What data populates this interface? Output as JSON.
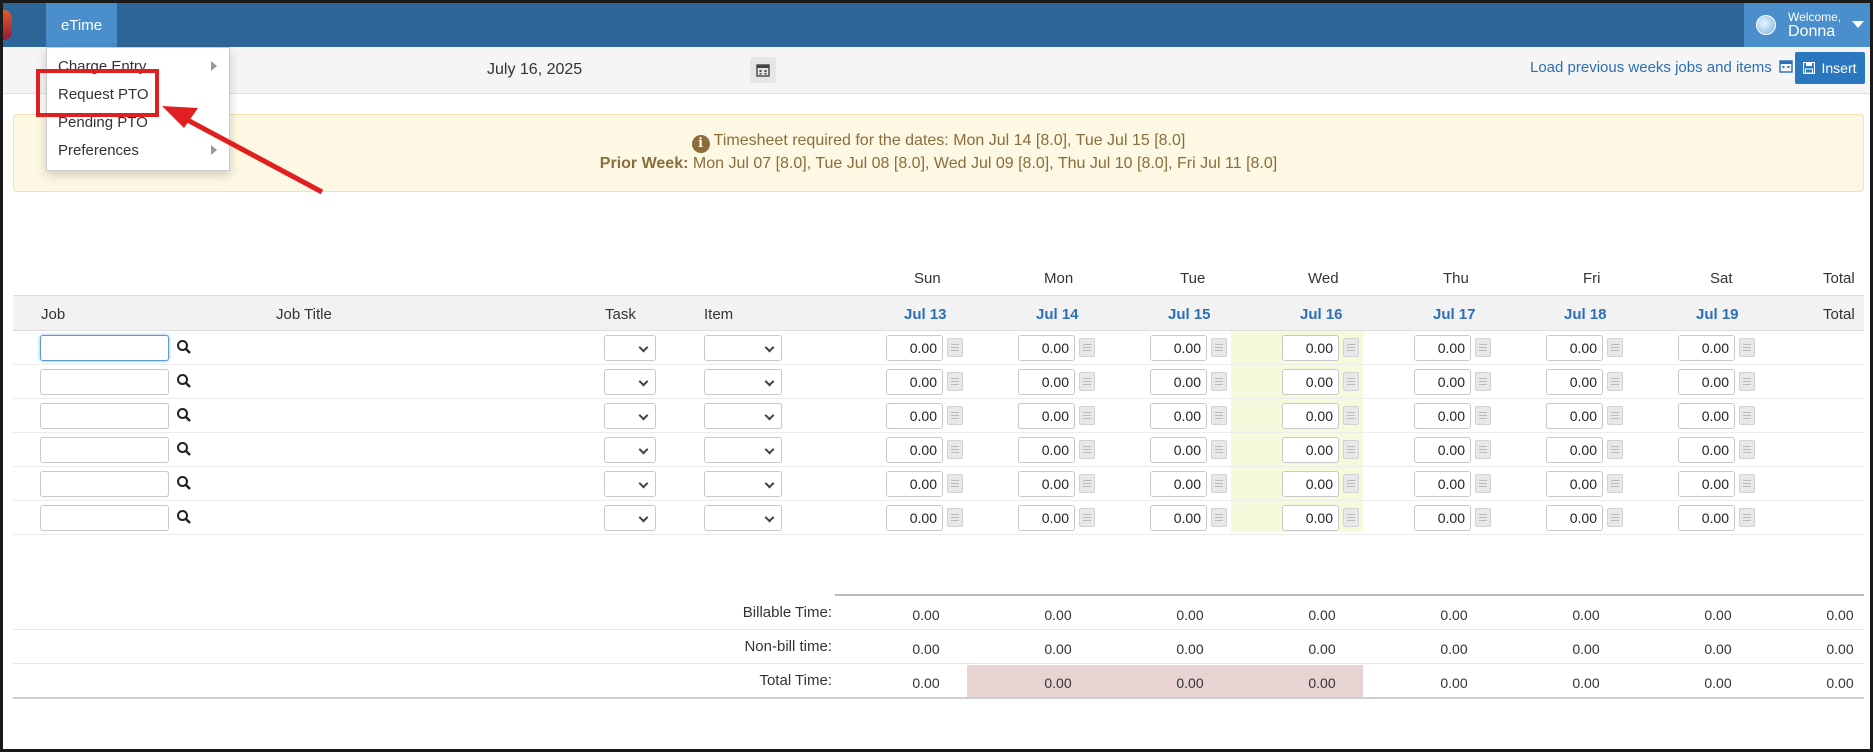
{
  "nav": {
    "app_label": "eTime",
    "welcome_line1": "Welcome,",
    "welcome_name": "Donna"
  },
  "menu": {
    "items": [
      {
        "label": "Charge Entry",
        "has_submenu": true
      },
      {
        "label": "Request PTO",
        "has_submenu": false
      },
      {
        "label": "Pending PTO",
        "has_submenu": false
      },
      {
        "label": "Preferences",
        "has_submenu": true
      }
    ]
  },
  "toolbar": {
    "date": "July 16, 2025",
    "load_previous": "Load previous weeks jobs and items",
    "insert_label": "Insert"
  },
  "alert": {
    "line1": "Timesheet required for the dates: Mon Jul 14 [8.0], Tue Jul 15 [8.0]",
    "prior_label": "Prior Week:",
    "prior_text": "Mon Jul 07 [8.0], Tue Jul 08 [8.0], Wed Jul 09 [8.0], Thu Jul 10 [8.0], Fri Jul 11 [8.0]"
  },
  "grid": {
    "day_names": [
      "Sun",
      "Mon",
      "Tue",
      "Wed",
      "Thu",
      "Fri",
      "Sat",
      "Total"
    ],
    "columns": {
      "job": "Job",
      "job_title": "Job Title",
      "task": "Task",
      "item": "Item",
      "total": "Total"
    },
    "dates": [
      "Jul 13",
      "Jul 14",
      "Jul 15",
      "Jul 16",
      "Jul 17",
      "Jul 18",
      "Jul 19"
    ],
    "highlight_day": "Jul 16",
    "rows": [
      {
        "job": "",
        "hours": [
          "0.00",
          "0.00",
          "0.00",
          "0.00",
          "0.00",
          "0.00",
          "0.00"
        ]
      },
      {
        "job": "",
        "hours": [
          "0.00",
          "0.00",
          "0.00",
          "0.00",
          "0.00",
          "0.00",
          "0.00"
        ]
      },
      {
        "job": "",
        "hours": [
          "0.00",
          "0.00",
          "0.00",
          "0.00",
          "0.00",
          "0.00",
          "0.00"
        ]
      },
      {
        "job": "",
        "hours": [
          "0.00",
          "0.00",
          "0.00",
          "0.00",
          "0.00",
          "0.00",
          "0.00"
        ]
      },
      {
        "job": "",
        "hours": [
          "0.00",
          "0.00",
          "0.00",
          "0.00",
          "0.00",
          "0.00",
          "0.00"
        ]
      },
      {
        "job": "",
        "hours": [
          "0.00",
          "0.00",
          "0.00",
          "0.00",
          "0.00",
          "0.00",
          "0.00"
        ]
      }
    ]
  },
  "summary": [
    {
      "label": "Billable Time:",
      "values": [
        "0.00",
        "0.00",
        "0.00",
        "0.00",
        "0.00",
        "0.00",
        "0.00",
        "0.00"
      ]
    },
    {
      "label": "Non-bill time:",
      "values": [
        "0.00",
        "0.00",
        "0.00",
        "0.00",
        "0.00",
        "0.00",
        "0.00",
        "0.00"
      ]
    },
    {
      "label": "Total Time:",
      "values": [
        "0.00",
        "0.00",
        "0.00",
        "0.00",
        "0.00",
        "0.00",
        "0.00",
        "0.00"
      ]
    }
  ],
  "colors": {
    "navbar": "#2f6699",
    "nav_active": "#4a8fcb",
    "link": "#2a6fb7",
    "alert_bg": "#fcf8e3",
    "alert_text": "#8a6d3b",
    "today_col": "#f3fbdc",
    "deficit": "#e8d3d3",
    "annotation": "#e02020"
  },
  "icons": {
    "calendar": "calendar-icon",
    "search": "search-icon",
    "info": "info-circle-icon",
    "save": "floppy-disk-icon",
    "note": "note-icon"
  }
}
